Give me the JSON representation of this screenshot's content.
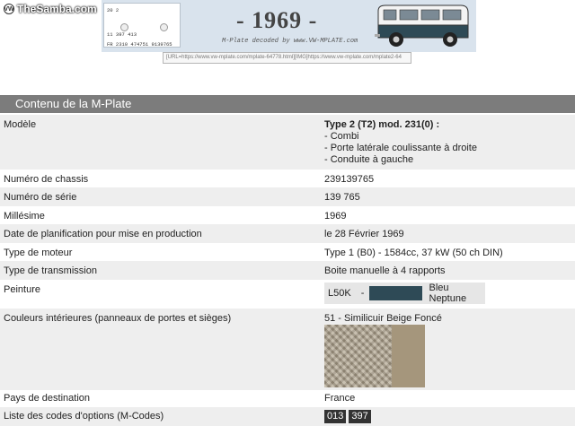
{
  "watermark": {
    "site": "TheSamba.com",
    "vw_glyph": "VW"
  },
  "banner": {
    "plate_line1": "20 2",
    "plate_line2": "11    397 413",
    "plate_line3": "FR  2310  474751  9139765",
    "year": "- 1969 -",
    "decoded_text": "M-Plate decoded by www.VW-MPLATE.com",
    "bus_color_upper": "#f4f4f4",
    "bus_color_lower": "#2e4a56"
  },
  "url_field": {
    "value": "[URL=https://www.vw-mplate.com/mplate-64778.html][IMG]https://www.vw-mplate.com/mplate2-64"
  },
  "section": {
    "title": "Contenu de la M-Plate"
  },
  "rows": {
    "modele": {
      "label": "Modèle",
      "title": "Type 2 (T2) mod. 231(0) :",
      "line1": "- Combi",
      "line2": "- Porte latérale coulissante à droite",
      "line3": "- Conduite à gauche"
    },
    "chassis": {
      "label": "Numéro de chassis",
      "value": "239139765"
    },
    "serie": {
      "label": "Numéro de série",
      "value": "139 765"
    },
    "millesime": {
      "label": "Millésime",
      "value": "1969"
    },
    "date": {
      "label": "Date de planification pour mise en production",
      "value": "le 28 Février 1969"
    },
    "moteur": {
      "label": "Type de moteur",
      "value": "Type 1 (B0) - 1584cc, 37 kW (50 ch DIN)"
    },
    "transmission": {
      "label": "Type de transmission",
      "value": "Boite manuelle à 4 rapports"
    },
    "peinture": {
      "label": "Peinture",
      "code": "L50K",
      "dash": "-",
      "swatch_color": "#2e4a56",
      "name": "Bleu Neptune"
    },
    "couleurs": {
      "label": "Couleurs intérieures (panneaux de portes et sièges)",
      "value": "51 - Similicuir Beige Foncé"
    },
    "pays": {
      "label": "Pays de destination",
      "value": "France"
    },
    "options": {
      "label": "Liste des codes d'options (M-Codes)",
      "codes": [
        "013",
        "397"
      ]
    }
  }
}
